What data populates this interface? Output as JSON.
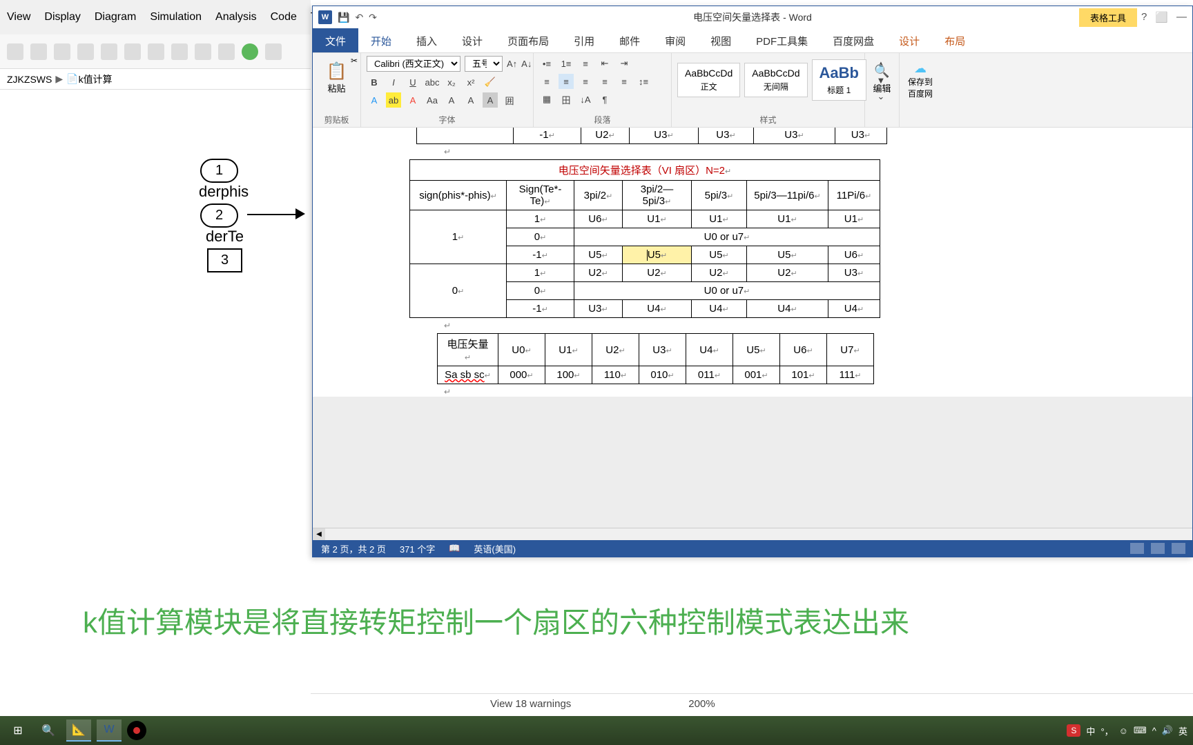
{
  "simulink": {
    "menu": [
      "View",
      "Display",
      "Diagram",
      "Simulation",
      "Analysis",
      "Code",
      "To"
    ],
    "breadcrumb": {
      "parent": "ZJKZSWS",
      "current": "k值计算"
    },
    "block1": {
      "num": "1",
      "label": "derphis"
    },
    "block2": {
      "num": "2",
      "label": "derTe"
    },
    "block3": {
      "num": "3"
    }
  },
  "word": {
    "title": "电压空间矢量选择表 - Word",
    "table_tools": "表格工具",
    "tabs": {
      "file": "文件",
      "home": "开始",
      "insert": "插入",
      "design": "设计",
      "layout": "页面布局",
      "ref": "引用",
      "mail": "邮件",
      "review": "审阅",
      "view": "视图",
      "pdf": "PDF工具集",
      "baidu": "百度网盘",
      "tdesign": "设计",
      "tlayout": "布局"
    },
    "ribbon": {
      "paste": "粘贴",
      "clipboard": "剪贴板",
      "font_name": "Calibri (西文正文)",
      "font_size": "五号",
      "font_group": "字体",
      "para_group": "段落",
      "style1": {
        "preview": "AaBbCcDd",
        "name": "正文"
      },
      "style2": {
        "preview": "AaBbCcDd",
        "name": "无间隔"
      },
      "style3": {
        "preview": "AaBb",
        "name": "标题 1"
      },
      "styles_group": "样式",
      "edit": "编辑",
      "save": "保存到",
      "baidu": "百度网"
    },
    "top_row": {
      "c1": "-1",
      "c2": "U2",
      "c3": "U3",
      "c4": "U3",
      "c5": "U3",
      "c6": "U3"
    },
    "table1": {
      "title": "电压空间矢量选择表（VI 扇区）N=2",
      "h1": "sign(phis*-phis)",
      "h2": "Sign(Te*-Te)",
      "h3": "3pi/2",
      "h4": "3pi/2—5pi/3",
      "h5": "5pi/3",
      "h6": "5pi/3—11pi/6",
      "h7": "11Pi/6",
      "g1": "1",
      "g2": "0",
      "r1": {
        "c1": "1",
        "c2": "U6",
        "c3": "U1",
        "c4": "U1",
        "c5": "U1",
        "c6": "U1"
      },
      "r2": {
        "c1": "0",
        "span": "U0 or u7"
      },
      "r3": {
        "c1": "-1",
        "c2": "U5",
        "c3": "U5",
        "c4": "U5",
        "c5": "U5",
        "c6": "U6"
      },
      "r4": {
        "c1": "1",
        "c2": "U2",
        "c3": "U2",
        "c4": "U2",
        "c5": "U2",
        "c6": "U3"
      },
      "r5": {
        "c1": "0",
        "span": "U0 or u7"
      },
      "r6": {
        "c1": "-1",
        "c2": "U3",
        "c3": "U4",
        "c4": "U4",
        "c5": "U4",
        "c6": "U4"
      }
    },
    "table2": {
      "h0": "电压矢量",
      "h1": "U0",
      "h2": "U1",
      "h3": "U2",
      "h4": "U3",
      "h5": "U4",
      "h6": "U5",
      "h7": "U6",
      "h8": "U7",
      "r0": "Sa sb sc",
      "v1": "000",
      "v2": "100",
      "v3": "110",
      "v4": "010",
      "v5": "011",
      "v6": "001",
      "v7": "101",
      "v8": "111"
    },
    "status": {
      "page": "第 2 页，共 2 页",
      "words": "371 个字",
      "lang": "英语(美国)"
    }
  },
  "sim_status": {
    "warn": "View 18 warnings",
    "zoom": "200%"
  },
  "caption": "k值计算模块是将直接转矩控制一个扇区的六种控制模式表达出来",
  "tray": {
    "ime": "S",
    "lang": "中",
    "lang2": "英"
  }
}
